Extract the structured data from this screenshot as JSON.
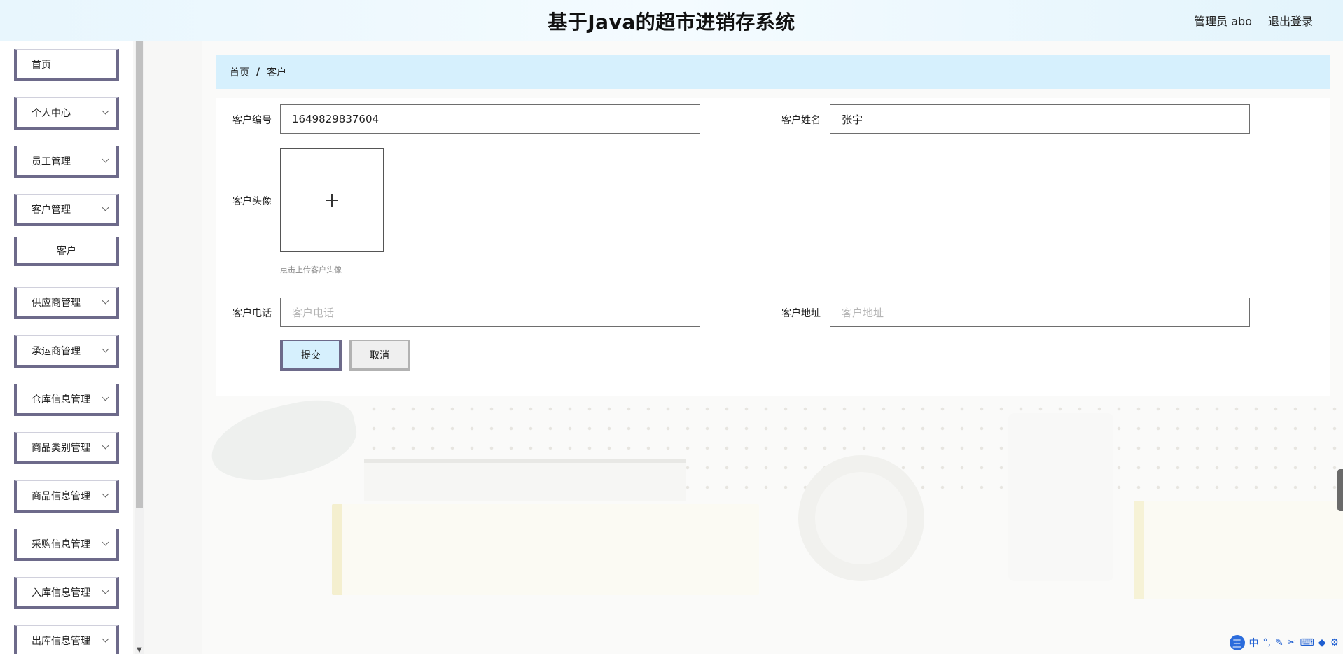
{
  "header": {
    "title": "基于Java的超市进销存系统",
    "user": "管理员 abo",
    "logout": "退出登录"
  },
  "sidebar": {
    "items": [
      {
        "label": "首页",
        "expandable": false
      },
      {
        "label": "个人中心",
        "expandable": true
      },
      {
        "label": "员工管理",
        "expandable": true
      },
      {
        "label": "客户管理",
        "expandable": true
      },
      {
        "label": "客户",
        "sub": true
      },
      {
        "label": "供应商管理",
        "expandable": true
      },
      {
        "label": "承运商管理",
        "expandable": true
      },
      {
        "label": "仓库信息管理",
        "expandable": true
      },
      {
        "label": "商品类别管理",
        "expandable": true
      },
      {
        "label": "商品信息管理",
        "expandable": true
      },
      {
        "label": "采购信息管理",
        "expandable": true
      },
      {
        "label": "入库信息管理",
        "expandable": true
      },
      {
        "label": "出库信息管理",
        "expandable": true
      }
    ]
  },
  "breadcrumb": {
    "home": "首页",
    "separator": "/",
    "current": "客户"
  },
  "form": {
    "customer_id": {
      "label": "客户编号",
      "value": "1649829837604"
    },
    "customer_name": {
      "label": "客户姓名",
      "value": "张宇"
    },
    "avatar": {
      "label": "客户头像",
      "tip": "点击上传客户头像"
    },
    "phone": {
      "label": "客户电话",
      "value": "",
      "placeholder": "客户电话"
    },
    "address": {
      "label": "客户地址",
      "value": "",
      "placeholder": "客户地址"
    },
    "submit": "提交",
    "cancel": "取消"
  },
  "ime": {
    "logo": "王",
    "mode": "中"
  },
  "colors": {
    "accent": "#d6f0fd",
    "menu_border": "#6d6a8a"
  }
}
